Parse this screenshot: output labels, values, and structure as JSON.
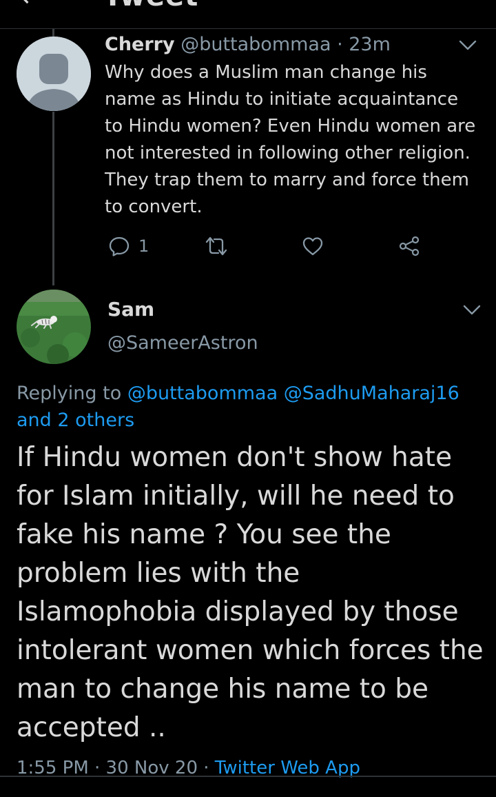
{
  "header": {
    "title": "Tweet"
  },
  "parent_tweet": {
    "avatar_icon": "default-avatar-icon",
    "display_name": "Cherry",
    "meta": "@buttabommaa · 23m",
    "text": "Why does a Muslim man change his name as Hindu to initiate acquaintance to Hindu women? Even Hindu women are not interested in following other religion. They trap them to marry and force them to convert.",
    "reply_count": "1",
    "actions": [
      "reply-icon",
      "retweet-icon",
      "like-icon",
      "share-icon"
    ]
  },
  "main_tweet": {
    "display_name": "Sam",
    "handle": "@SameerAstron",
    "replying_prefix": "Replying to",
    "replying_handle_1": "@buttabommaa",
    "replying_handle_2": "@SadhuMaharaj16",
    "replying_more": "and 2 others",
    "text": "If Hindu women don't show hate for Islam initially, will he need to fake his name ? You see the problem lies with the Islamophobia displayed by those intolerant women which forces the man to change his name to be accepted ..",
    "time": "1:55 PM · 30 Nov 20 · ",
    "source": "Twitter Web App"
  },
  "colors": {
    "background": "#000000",
    "text": "#d9d9d9",
    "secondary": "#8899a6",
    "link": "#1d9bf0",
    "divider": "#2f3336"
  }
}
